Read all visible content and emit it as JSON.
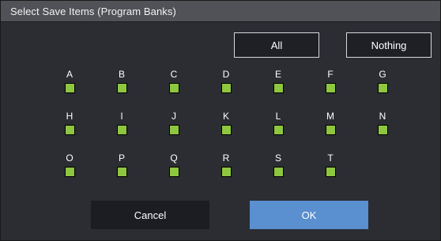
{
  "dialog": {
    "title": "Select Save Items (Program Banks)"
  },
  "buttons": {
    "all_label": "All",
    "nothing_label": "Nothing",
    "cancel_label": "Cancel",
    "ok_label": "OK"
  },
  "banks": [
    {
      "label": "A",
      "checked": true
    },
    {
      "label": "B",
      "checked": true
    },
    {
      "label": "C",
      "checked": true
    },
    {
      "label": "D",
      "checked": true
    },
    {
      "label": "E",
      "checked": true
    },
    {
      "label": "F",
      "checked": true
    },
    {
      "label": "G",
      "checked": true
    },
    {
      "label": "H",
      "checked": true
    },
    {
      "label": "I",
      "checked": true
    },
    {
      "label": "J",
      "checked": true
    },
    {
      "label": "K",
      "checked": true
    },
    {
      "label": "L",
      "checked": true
    },
    {
      "label": "M",
      "checked": true
    },
    {
      "label": "N",
      "checked": true
    },
    {
      "label": "O",
      "checked": true
    },
    {
      "label": "P",
      "checked": true
    },
    {
      "label": "Q",
      "checked": true
    },
    {
      "label": "R",
      "checked": true
    },
    {
      "label": "S",
      "checked": true
    },
    {
      "label": "T",
      "checked": true
    }
  ],
  "colors": {
    "checkbox_checked": "#8ec63f",
    "ok_button": "#5a8fd0",
    "title_bar": "#505257",
    "background": "#2b2d33"
  }
}
